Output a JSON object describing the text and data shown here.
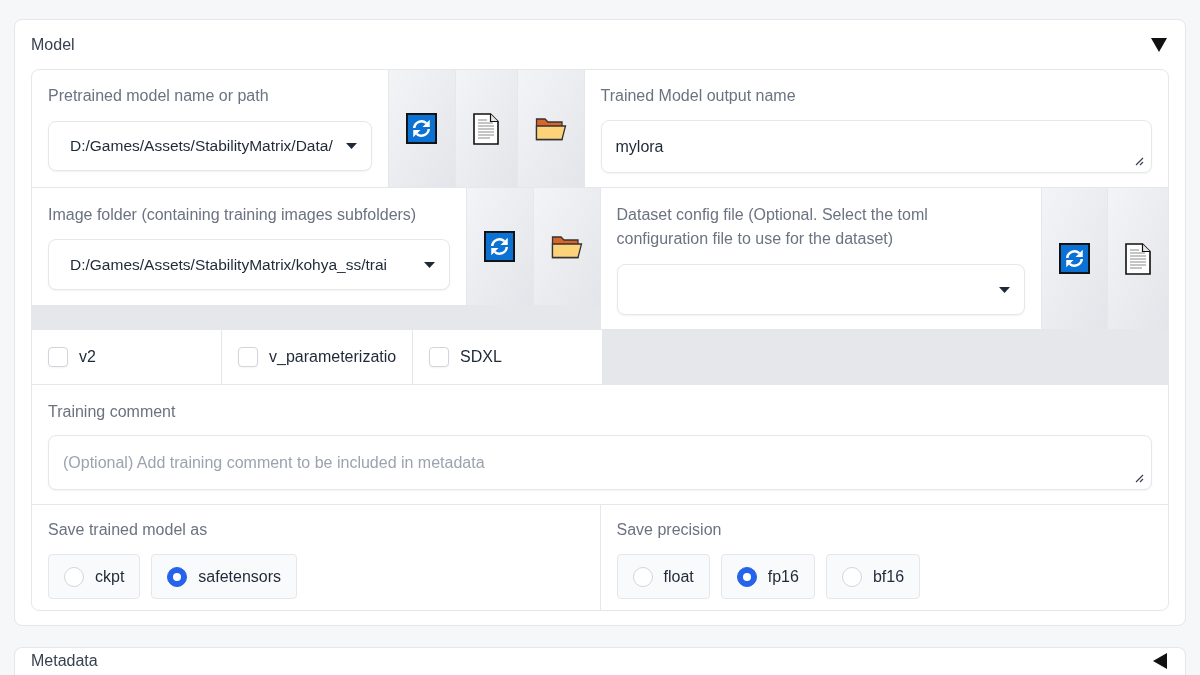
{
  "model_panel": {
    "title": "Model",
    "expanded": true
  },
  "pretrained_model": {
    "label": "Pretrained model name or path",
    "value": "D:/Games/Assets/StabilityMatrix/Data/",
    "buttons": [
      {
        "kind": "refresh"
      },
      {
        "kind": "file"
      },
      {
        "kind": "folder"
      }
    ]
  },
  "output_name": {
    "label": "Trained Model output name",
    "value": "mylora"
  },
  "image_folder": {
    "label": "Image folder (containing training images subfolders)",
    "value": "D:/Games/Assets/StabilityMatrix/kohya_ss/trai",
    "buttons": [
      {
        "kind": "refresh"
      },
      {
        "kind": "folder"
      }
    ]
  },
  "dataset_config": {
    "label": "Dataset config file (Optional. Select the toml configuration file to use for the dataset)",
    "buttons": [
      {
        "kind": "refresh"
      },
      {
        "kind": "file"
      }
    ]
  },
  "checkboxes": [
    {
      "label": "v2",
      "checked": false
    },
    {
      "label": "v_parameterizatio",
      "checked": false
    },
    {
      "label": "SDXL",
      "checked": false
    }
  ],
  "training_comment": {
    "label": "Training comment",
    "placeholder": "(Optional) Add training comment to be included in metadata"
  },
  "save_model_as": {
    "label": "Save trained model as",
    "options": [
      {
        "label": "ckpt",
        "selected": false
      },
      {
        "label": "safetensors",
        "selected": true
      }
    ]
  },
  "save_precision": {
    "label": "Save precision",
    "options": [
      {
        "label": "float",
        "selected": false
      },
      {
        "label": "fp16",
        "selected": true
      },
      {
        "label": "bf16",
        "selected": false
      }
    ]
  },
  "metadata_panel": {
    "title": "Metadata",
    "expanded": false
  }
}
